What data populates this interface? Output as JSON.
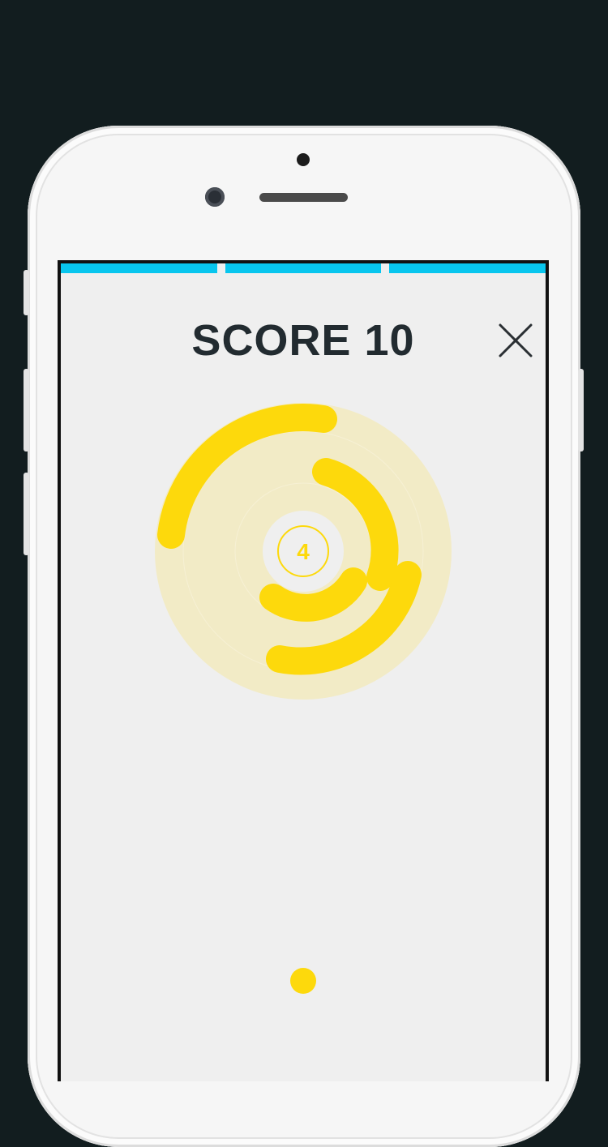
{
  "header": {
    "score_label": "SCORE",
    "score_value": "10"
  },
  "level": {
    "center_number": "4",
    "progress_segments": 3
  },
  "colors": {
    "background": "#121d1f",
    "progress": "#08c6ee",
    "arc": "#fdd90c",
    "disc": "#f2ebc6",
    "text": "#222b30"
  },
  "icons": {
    "close": "close-icon"
  }
}
